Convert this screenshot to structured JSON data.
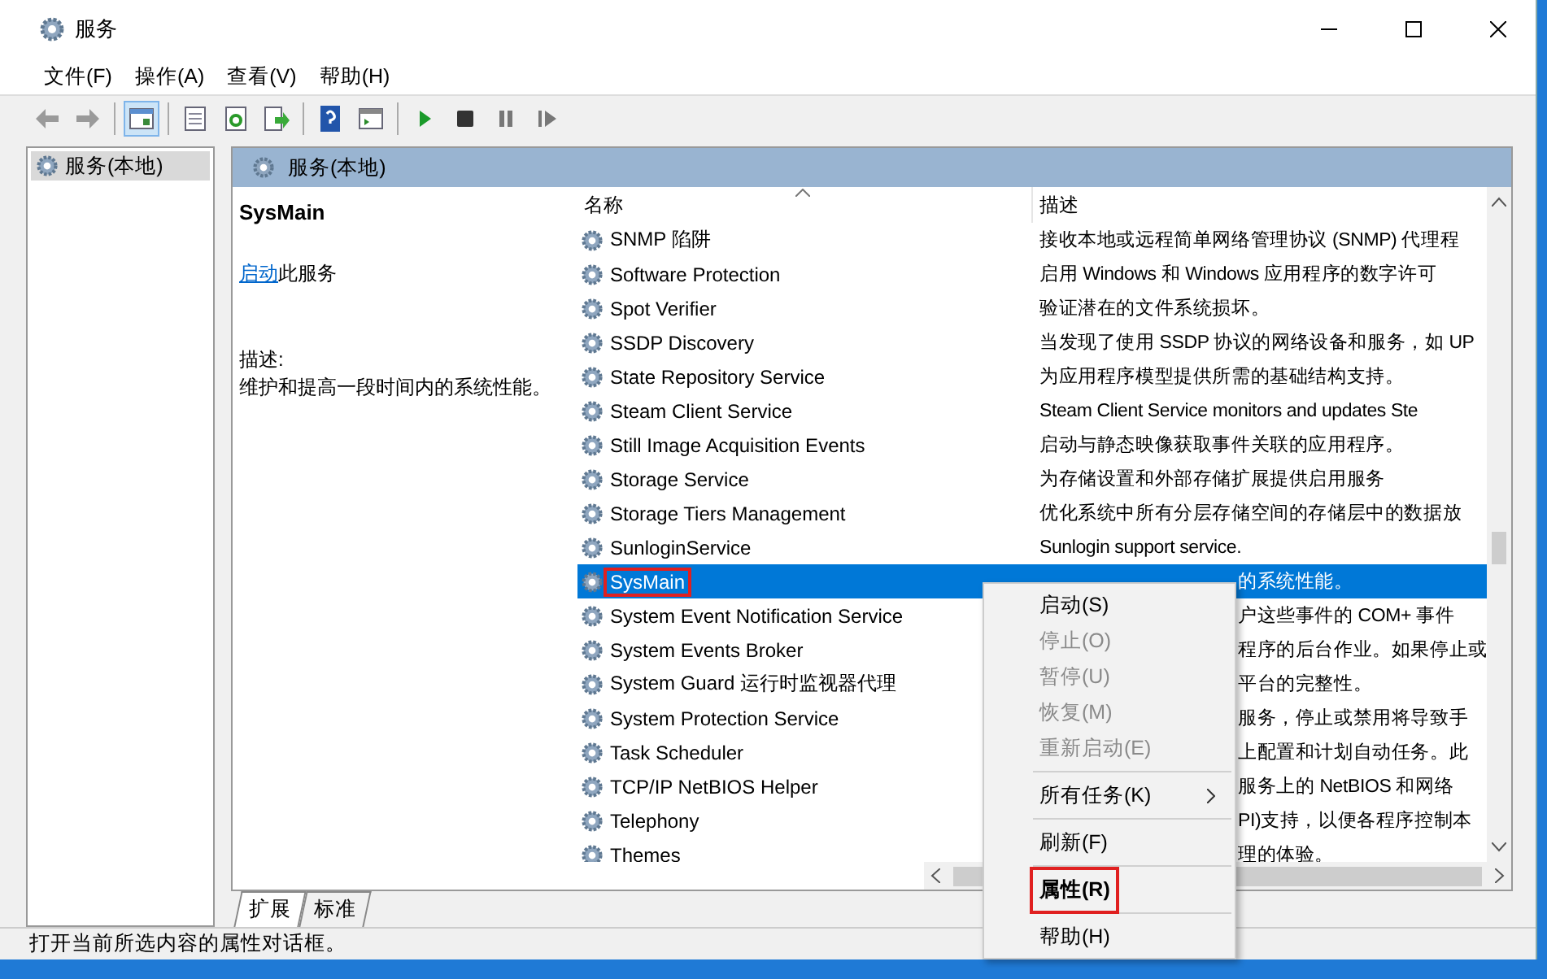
{
  "window": {
    "title": "服务"
  },
  "menu": [
    "文件(F)",
    "操作(A)",
    "查看(V)",
    "帮助(H)"
  ],
  "toolbar": [
    [
      {
        "kind": "back",
        "selected": false
      },
      {
        "kind": "forward",
        "selected": false
      }
    ],
    [
      {
        "kind": "tree",
        "selected": true
      }
    ],
    [
      {
        "kind": "props",
        "selected": false
      },
      {
        "kind": "refresh",
        "selected": false
      },
      {
        "kind": "export",
        "selected": false
      }
    ],
    [
      {
        "kind": "help",
        "selected": false
      },
      {
        "kind": "view",
        "selected": false
      }
    ],
    [
      {
        "kind": "play",
        "selected": false
      },
      {
        "kind": "stop",
        "selected": false
      },
      {
        "kind": "pause",
        "selected": false
      },
      {
        "kind": "resume",
        "selected": false
      }
    ]
  ],
  "tree": [
    {
      "label": "服务(本地)",
      "selected": true
    }
  ],
  "pane": {
    "header": "服务(本地)",
    "service_name": "SysMain",
    "action_link": "启动",
    "action_text": "此服务",
    "desc_label": "描述:",
    "desc": "维护和提高一段时间内的系统性能。"
  },
  "columns": [
    "名称",
    "描述"
  ],
  "rows": [
    {
      "name": "SNMP 陷阱",
      "description": "接收本地或远程简单网络管理协议 (SNMP) 代理程",
      "selected": false,
      "highlighted": false
    },
    {
      "name": "Software Protection",
      "description": "启用 Windows 和 Windows 应用程序的数字许可",
      "selected": false,
      "highlighted": false
    },
    {
      "name": "Spot Verifier",
      "description": "验证潜在的文件系统损坏。",
      "selected": false,
      "highlighted": false
    },
    {
      "name": "SSDP Discovery",
      "description": "当发现了使用 SSDP 协议的网络设备和服务，如 UP",
      "selected": false,
      "highlighted": false
    },
    {
      "name": "State Repository Service",
      "description": "为应用程序模型提供所需的基础结构支持。",
      "selected": false,
      "highlighted": false
    },
    {
      "name": "Steam Client Service",
      "description": "Steam Client Service monitors and updates Ste",
      "selected": false,
      "highlighted": false
    },
    {
      "name": "Still Image Acquisition Events",
      "description": "启动与静态映像获取事件关联的应用程序。",
      "selected": false,
      "highlighted": false
    },
    {
      "name": "Storage Service",
      "description": "为存储设置和外部存储扩展提供启用服务",
      "selected": false,
      "highlighted": false
    },
    {
      "name": "Storage Tiers Management",
      "description": "优化系统中所有分层存储空间的存储层中的数据放",
      "selected": false,
      "highlighted": false
    },
    {
      "name": "SunloginService",
      "description": "Sunlogin support service.",
      "selected": false,
      "highlighted": false
    },
    {
      "name": "SysMain",
      "description": "的系统性能。",
      "selected": true,
      "highlighted": true
    },
    {
      "name": "System Event Notification Service",
      "description": "户这些事件的 COM+ 事件",
      "selected": false,
      "highlighted": false
    },
    {
      "name": "System Events Broker",
      "description": "程序的后台作业。如果停止或",
      "selected": false,
      "highlighted": false
    },
    {
      "name": "System Guard 运行时监视器代理",
      "description": "平台的完整性。",
      "selected": false,
      "highlighted": false
    },
    {
      "name": "System Protection Service",
      "description": "服务，停止或禁用将导致手",
      "selected": false,
      "highlighted": false
    },
    {
      "name": "Task Scheduler",
      "description": "上配置和计划自动任务。此",
      "selected": false,
      "highlighted": false
    },
    {
      "name": "TCP/IP NetBIOS Helper",
      "description": "服务上的 NetBIOS 和网络",
      "selected": false,
      "highlighted": false
    },
    {
      "name": "Telephony",
      "description": "PI)支持，以便各程序控制本",
      "selected": false,
      "highlighted": false
    },
    {
      "name": "Themes",
      "description": "理的体验。",
      "selected": false,
      "highlighted": false
    }
  ],
  "tabs": [
    {
      "label": "扩展",
      "selected": true
    },
    {
      "label": "标准",
      "selected": false
    }
  ],
  "context_menu": [
    [
      {
        "label": "启动(S)",
        "disabled": false,
        "bold": false,
        "submenu": false,
        "highlighted": false
      },
      {
        "label": "停止(O)",
        "disabled": true,
        "bold": false,
        "submenu": false,
        "highlighted": false
      },
      {
        "label": "暂停(U)",
        "disabled": true,
        "bold": false,
        "submenu": false,
        "highlighted": false
      },
      {
        "label": "恢复(M)",
        "disabled": true,
        "bold": false,
        "submenu": false,
        "highlighted": false
      },
      {
        "label": "重新启动(E)",
        "disabled": true,
        "bold": false,
        "submenu": false,
        "highlighted": false
      }
    ],
    [
      {
        "label": "所有任务(K)",
        "disabled": false,
        "bold": false,
        "submenu": true,
        "highlighted": false
      }
    ],
    [
      {
        "label": "刷新(F)",
        "disabled": false,
        "bold": false,
        "submenu": false,
        "highlighted": false
      }
    ],
    [
      {
        "label": "属性(R)",
        "disabled": false,
        "bold": true,
        "submenu": false,
        "highlighted": true
      }
    ],
    [
      {
        "label": "帮助(H)",
        "disabled": false,
        "bold": false,
        "submenu": false,
        "highlighted": false
      }
    ]
  ],
  "status_bar": "打开当前所选内容的属性对话框。"
}
